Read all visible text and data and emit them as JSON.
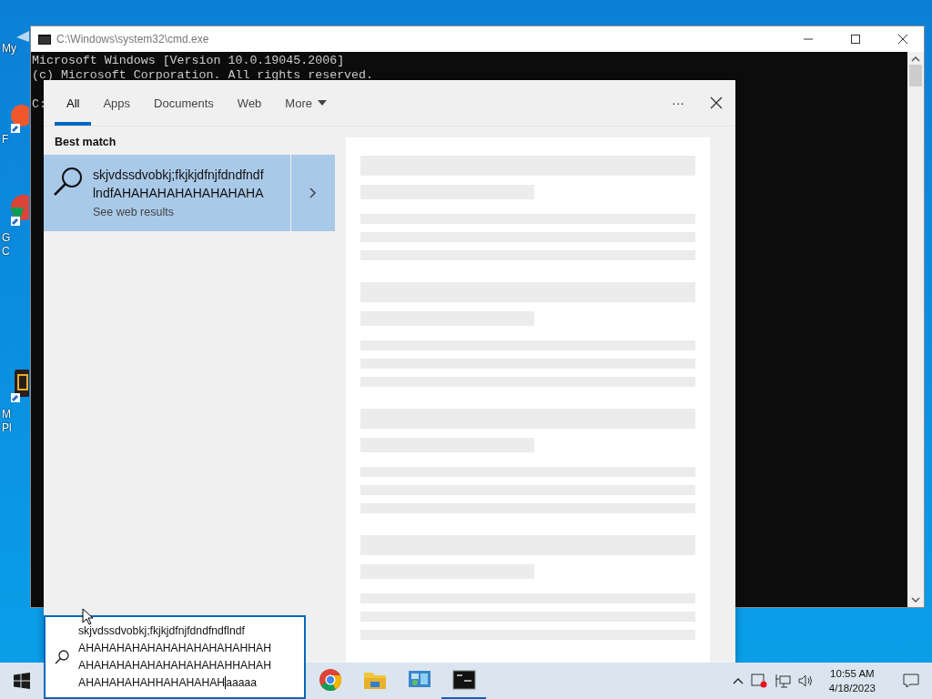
{
  "desktop_icons": [
    {
      "kind": "computer",
      "lines": [
        "My"
      ]
    },
    {
      "kind": "firefox",
      "lines": [
        "F"
      ]
    },
    {
      "kind": "chrome",
      "lines": [
        "G",
        "C"
      ]
    },
    {
      "kind": "media",
      "lines": [
        "M",
        "Pl"
      ]
    }
  ],
  "console_window": {
    "title": "C:\\Windows\\system32\\cmd.exe",
    "lines": [
      {
        "text": "Microsoft Windows [Version 10.0.19045.2006]",
        "space_before": false
      },
      {
        "text": "(c) Microsoft Corporation. All rights reserved.",
        "space_before": false
      },
      {
        "text": "C:",
        "space_before": true
      }
    ]
  },
  "search_panel": {
    "tabs": [
      {
        "label": "All",
        "selected": true,
        "has_menu": false
      },
      {
        "label": "Apps",
        "selected": false,
        "has_menu": false
      },
      {
        "label": "Documents",
        "selected": false,
        "has_menu": false
      },
      {
        "label": "Web",
        "selected": false,
        "has_menu": false
      },
      {
        "label": "More",
        "selected": false,
        "has_menu": true
      }
    ],
    "more_options": "···",
    "section_title": "Best match",
    "best_match": {
      "title_lines": [
        "skjvdssdvobkj;fkjkjdfnjfdndfndf",
        "lndfAHAHAHAHAHAHAHAHA"
      ],
      "subtitle": "See web results",
      "selected": true
    }
  },
  "search_box": {
    "lines": [
      "skjvdssdvobkj;fkjkjdfnjfdndfndflndf",
      "AHAHAHAHAHAHAHAHAHAHAHHAH",
      "AHAHAHAHAHAHAHAHAHAHHAHAH",
      "AHAHAHAHAHHAHAHAHAH"
    ],
    "tail": "aaaaa"
  },
  "taskbar": {
    "apps": [
      {
        "kind": "chrome",
        "active": false
      },
      {
        "kind": "folder",
        "active": false
      },
      {
        "kind": "control",
        "active": false
      },
      {
        "kind": "terminal",
        "active": true
      }
    ],
    "time": "10:55 AM",
    "date": "4/18/2023"
  }
}
